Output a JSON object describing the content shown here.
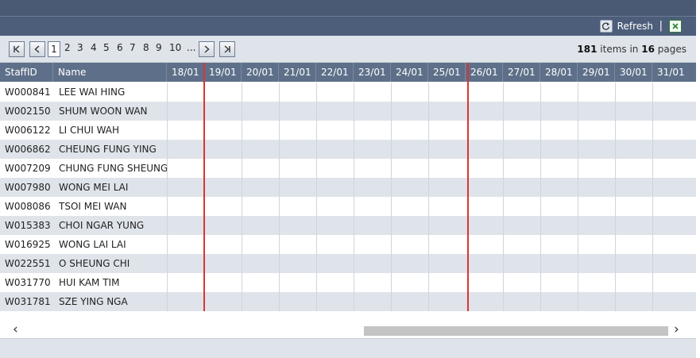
{
  "toolbar": {
    "refresh_label": "Refresh",
    "separator": "|"
  },
  "pager": {
    "pages": [
      "1",
      "2",
      "3",
      "4",
      "5",
      "6",
      "7",
      "8",
      "9",
      "10",
      "..."
    ],
    "active_page": "1",
    "total_items": "181",
    "items_text": "items in",
    "total_pages": "16",
    "pages_text": "pages"
  },
  "grid": {
    "columns": [
      "StaffID",
      "Name",
      "18/01",
      "19/01",
      "20/01",
      "21/01",
      "22/01",
      "23/01",
      "24/01",
      "25/01",
      "26/01",
      "27/01",
      "28/01",
      "29/01",
      "30/01",
      "31/01"
    ],
    "rows": [
      {
        "id": "W000841",
        "name": "LEE WAI HING"
      },
      {
        "id": "W002150",
        "name": "SHUM WOON WAN"
      },
      {
        "id": "W006122",
        "name": "LI CHUI WAH"
      },
      {
        "id": "W006862",
        "name": "CHEUNG FUNG YING"
      },
      {
        "id": "W007209",
        "name": "CHUNG FUNG SHEUNG"
      },
      {
        "id": "W007980",
        "name": "WONG MEI LAI"
      },
      {
        "id": "W008086",
        "name": "TSOI MEI WAN"
      },
      {
        "id": "W015383",
        "name": "CHOI NGAR YUNG"
      },
      {
        "id": "W016925",
        "name": "WONG LAI LAI"
      },
      {
        "id": "W022551",
        "name": "O SHEUNG CHI"
      },
      {
        "id": "W031770",
        "name": "HUI KAM TIM"
      },
      {
        "id": "W031781",
        "name": "SZE YING NGA"
      }
    ]
  },
  "icons": {
    "refresh": "refresh-icon",
    "export": "excel-export-icon",
    "first": "first-page-icon",
    "prev": "prev-page-icon",
    "next": "next-page-icon",
    "last": "last-page-icon",
    "scroll_left": "chevron-left-icon",
    "scroll_right": "chevron-right-icon"
  },
  "colors": {
    "header_bg": "#5e7089",
    "toolbar_bg": "#4d5e7b",
    "alt_row": "#dfe4ea",
    "marker": "#d33333"
  }
}
